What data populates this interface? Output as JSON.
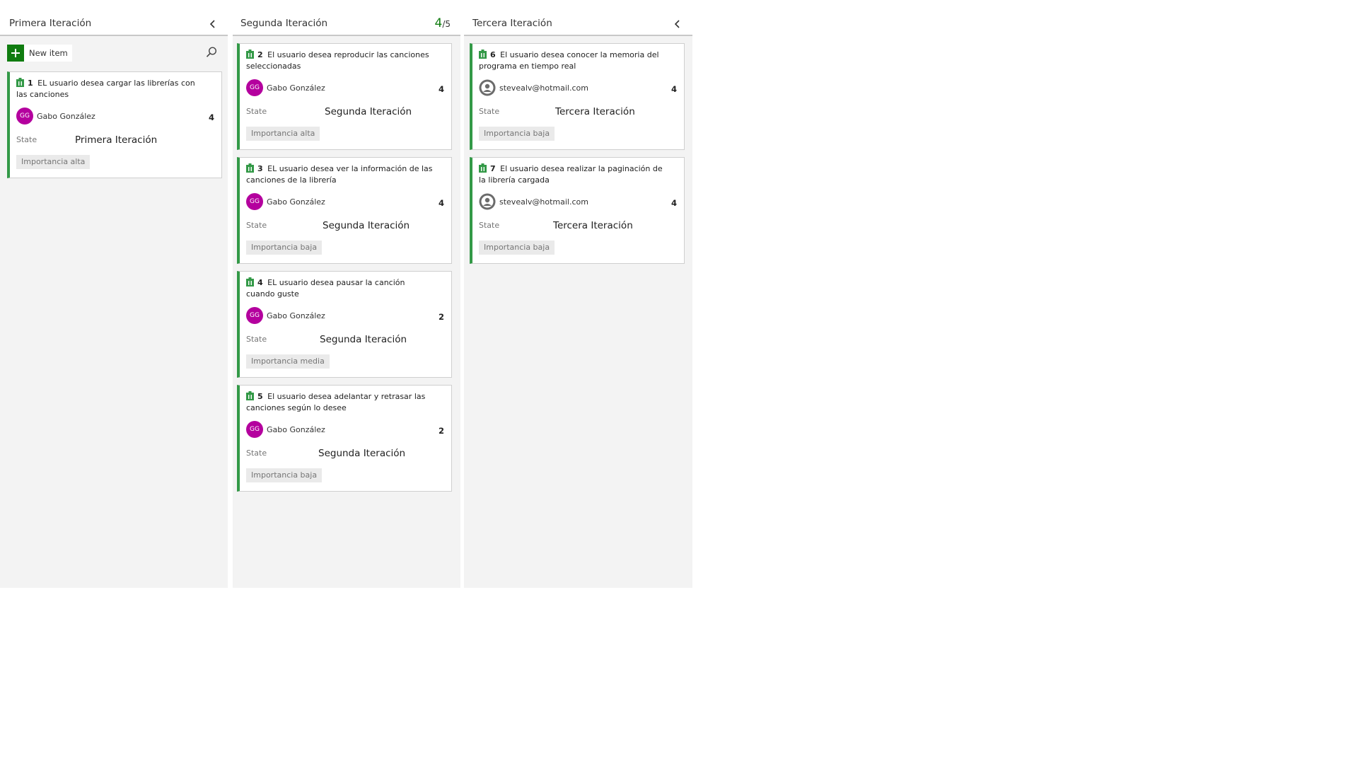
{
  "columns": [
    {
      "title": "Primera Iteración",
      "new_item_label": "New item",
      "cards": [
        {
          "id": "1",
          "title": "EL usuario desea cargar las librerías con las canciones",
          "assignee_initials": "GG",
          "assignee": "Gabo González",
          "effort": "4",
          "state_label": "State",
          "state": "Primera Iteración",
          "tag": "Importancia alta"
        }
      ]
    },
    {
      "title": "Segunda Iteración",
      "wip_count": "4",
      "wip_limit": "5",
      "cards": [
        {
          "id": "2",
          "title": "El usuario desea reproducir las canciones seleccionadas",
          "assignee_initials": "GG",
          "assignee": "Gabo González",
          "effort": "4",
          "state_label": "State",
          "state": "Segunda Iteración",
          "tag": "Importancia alta"
        },
        {
          "id": "3",
          "title": "EL usuario desea ver la información de las canciones de la librería",
          "assignee_initials": "GG",
          "assignee": "Gabo González",
          "effort": "4",
          "state_label": "State",
          "state": "Segunda Iteración",
          "tag": "Importancia baja"
        },
        {
          "id": "4",
          "title": "EL usuario desea pausar la canción cuando guste",
          "assignee_initials": "GG",
          "assignee": "Gabo González",
          "effort": "2",
          "state_label": "State",
          "state": "Segunda Iteración",
          "tag": "Importancia media"
        },
        {
          "id": "5",
          "title": "El usuario desea adelantar y retrasar las canciones según lo desee",
          "assignee_initials": "GG",
          "assignee": "Gabo González",
          "effort": "2",
          "state_label": "State",
          "state": "Segunda Iteración",
          "tag": "Importancia baja"
        }
      ]
    },
    {
      "title": "Tercera Iteración",
      "cards": [
        {
          "id": "6",
          "title": "El usuario desea conocer la memoria del programa en tiempo real",
          "assignee": "stevealv@hotmail.com",
          "effort": "4",
          "state_label": "State",
          "state": "Tercera Iteración",
          "tag": "Importancia baja"
        },
        {
          "id": "7",
          "title": "El usuario desea realizar la paginación de la librería cargada",
          "assignee": "stevealv@hotmail.com",
          "effort": "4",
          "state_label": "State",
          "state": "Tercera Iteración",
          "tag": "Importancia baja"
        }
      ]
    }
  ],
  "colors": {
    "accent_green": "#107c10",
    "card_border": "#339947",
    "avatar_magenta": "#b4009e",
    "column_background": "#f3f3f3"
  },
  "icons": {
    "collapse": "chevron-left-icon",
    "search": "search-icon",
    "add": "plus-icon",
    "work_item": "user-story-icon",
    "generic_avatar": "person-icon"
  }
}
